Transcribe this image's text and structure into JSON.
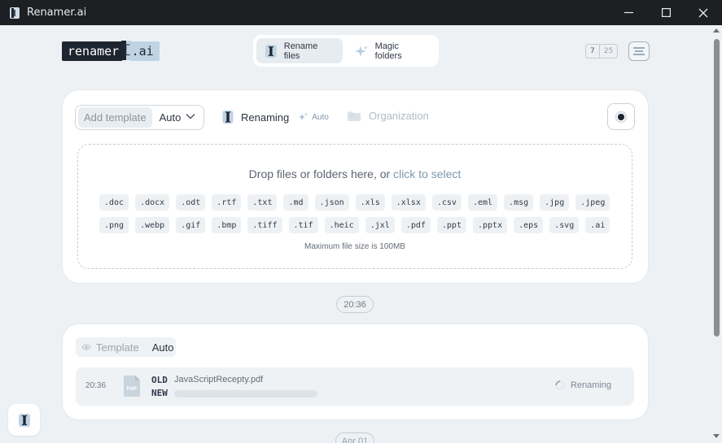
{
  "window": {
    "title": "Renamer.ai",
    "icons": {
      "app": "app-logo-icon",
      "minimize": "minimize-icon",
      "maximize": "maximize-icon",
      "close": "close-icon"
    }
  },
  "header": {
    "logo": {
      "main": "renamer",
      "suffix": ".ai"
    },
    "modes": [
      {
        "label": "Rename files",
        "icon": "text-cursor-icon",
        "active": true
      },
      {
        "label": "Magic folders",
        "icon": "sparkle-icon",
        "active": false
      }
    ],
    "usage": {
      "used": "7",
      "total": "25"
    },
    "menu_icon": "menu-icon"
  },
  "upload": {
    "template": {
      "add_label": "Add template",
      "value": "Auto"
    },
    "renaming_label": "Renaming",
    "auto_label": "Auto",
    "organization_label": "Organization",
    "drop_text": "Drop files or folders here, or ",
    "drop_link": "click to select",
    "extensions_row1": [
      ".doc",
      ".docx",
      ".odt",
      ".rtf",
      ".txt",
      ".md",
      ".json",
      ".xls",
      ".xlsx",
      ".csv",
      ".eml",
      ".msg",
      ".jpg",
      ".jpeg"
    ],
    "extensions_row2": [
      ".png",
      ".webp",
      ".gif",
      ".bmp",
      ".tiff",
      ".tif",
      ".heic",
      ".jxl",
      ".pdf",
      ".ppt",
      ".pptx",
      ".eps",
      ".svg",
      ".ai"
    ],
    "max_size": "Maximum file size is 100MB"
  },
  "timeline": {
    "time": "20:36",
    "next_date": "Apr 01"
  },
  "job": {
    "template_label": "Template",
    "template_value": "Auto",
    "file": {
      "time": "20:36",
      "type_label": "PDF",
      "old_label": "OLD",
      "new_label": "NEW",
      "old_name": "JavaScriptRecepty.pdf",
      "status": "Renaming"
    }
  },
  "colors": {
    "accent": "#7b98ae",
    "logo_dark": "#1d2530",
    "logo_light": "#bfd3e3",
    "titlebar": "#1d1f23",
    "background": "#eef1f3"
  }
}
